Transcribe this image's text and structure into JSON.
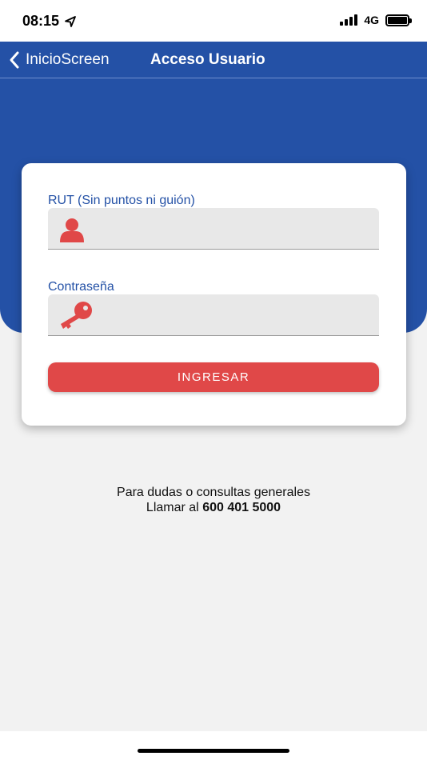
{
  "status_bar": {
    "time": "08:15",
    "network": "4G",
    "battery_level": 1.0,
    "signal_bars": 4
  },
  "nav": {
    "back_label": "InicioScreen",
    "title": "Acceso Usuario"
  },
  "form": {
    "rut_label": "RUT (Sin puntos ni guión)",
    "rut_value": "",
    "password_label": "Contraseña",
    "password_value": "",
    "submit_label": "INGRESAR"
  },
  "contact": {
    "line1": "Para dudas o consultas generales",
    "line2_prefix": "Llamar al",
    "phone": "600 401 5000"
  },
  "colors": {
    "primary": "#2451a6",
    "accent": "#e04848",
    "field_bg": "#e8e8e8",
    "page_bg": "#f2f2f2"
  },
  "icons": {
    "rut": "user-icon",
    "password": "key-icon",
    "back": "chevron-left-icon",
    "location": "location-arrow-icon"
  }
}
